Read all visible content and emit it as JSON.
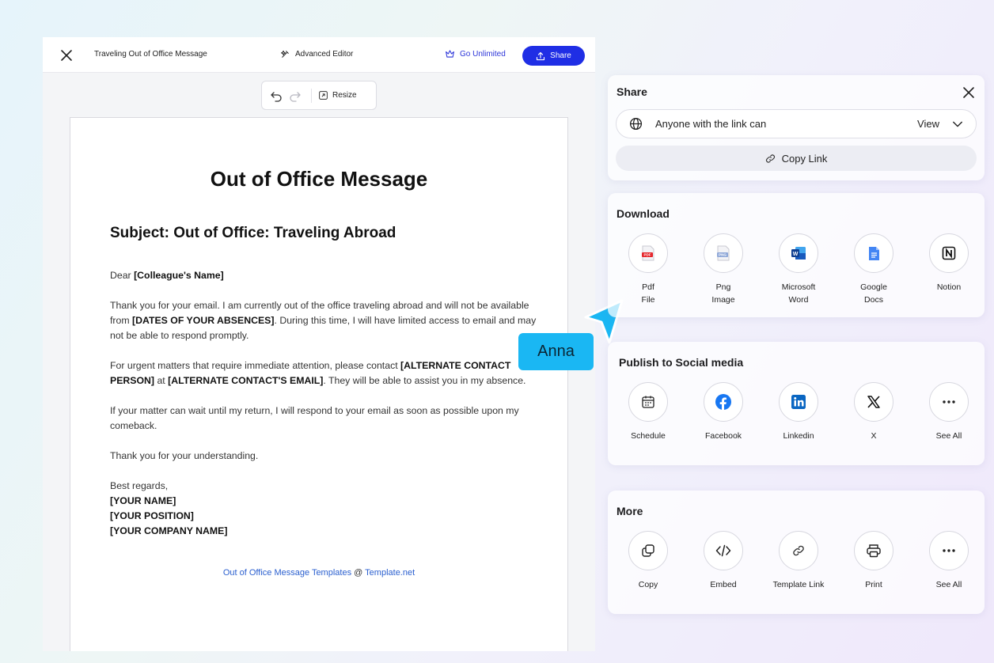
{
  "editor": {
    "title": "Traveling Out of Office Message",
    "advanced_editor": "Advanced Editor",
    "go_unlimited": "Go Unlimited",
    "share": "Share",
    "resize": "Resize"
  },
  "document": {
    "title": "Out of Office Message",
    "subject": "Subject: Out of Office: Traveling Abroad",
    "greeting_pre": "Dear ",
    "greeting_name": "[Colleague's Name]",
    "para1_a": "Thank you for your email. I am currently out of the office traveling abroad and will not be available from ",
    "para1_b": "[DATES OF YOUR ABSENCES]",
    "para1_c": ". During this time, I will have limited access to email and may not be able to respond promptly.",
    "para2_a": "For urgent matters that require immediate attention, please contact ",
    "para2_b": "[ALTERNATE CONTACT PERSON]",
    "para2_c": " at ",
    "para2_d": "[ALTERNATE CONTACT'S EMAIL]",
    "para2_e": ". They will be able to assist you in my absence.",
    "para3": "If your matter can wait until my return, I will respond to your email as soon as possible upon my comeback.",
    "para4": "Thank you for your understanding.",
    "closing": "Best regards,",
    "name": "[YOUR NAME]",
    "position": "[YOUR POSITION]",
    "company": "[YOUR COMPANY NAME]",
    "footer_link": "Out of Office Message Templates",
    "footer_at": " @ ",
    "footer_site": "Template.net"
  },
  "cursor": {
    "label": "Anna",
    "color": "#1ab7f3"
  },
  "share_panel": {
    "title": "Share",
    "link_scope": "Anyone with the link can",
    "permission": "View",
    "copy_link": "Copy Link"
  },
  "download_panel": {
    "title": "Download",
    "items": [
      {
        "icon": "pdf-file-icon",
        "line1": "Pdf",
        "line2": "File"
      },
      {
        "icon": "png-image-icon",
        "line1": "Png",
        "line2": "Image"
      },
      {
        "icon": "microsoft-word-icon",
        "line1": "Microsoft",
        "line2": "Word"
      },
      {
        "icon": "google-docs-icon",
        "line1": "Google",
        "line2": "Docs"
      },
      {
        "icon": "notion-icon",
        "line1": "Notion",
        "line2": ""
      }
    ]
  },
  "social_panel": {
    "title": "Publish to Social media",
    "items": [
      {
        "icon": "calendar-icon",
        "line1": "Schedule"
      },
      {
        "icon": "facebook-icon",
        "line1": "Facebook"
      },
      {
        "icon": "linkedin-icon",
        "line1": "Linkedin"
      },
      {
        "icon": "x-icon",
        "line1": "X"
      },
      {
        "icon": "more-icon",
        "line1": "See All"
      }
    ]
  },
  "more_panel": {
    "title": "More",
    "items": [
      {
        "icon": "copy-icon",
        "line1": "Copy"
      },
      {
        "icon": "embed-icon",
        "line1": "Embed"
      },
      {
        "icon": "link-icon",
        "line1": "Template Link"
      },
      {
        "icon": "printer-icon",
        "line1": "Print"
      },
      {
        "icon": "more-icon",
        "line1": "See All"
      }
    ]
  },
  "colors": {
    "primary": "#1f2ee5",
    "link": "#2a5fcf",
    "facebook": "#1877f2",
    "linkedin": "#0a66c2",
    "word": "#185abd",
    "google_docs": "#4285f4",
    "pdf": "#e5252a"
  }
}
